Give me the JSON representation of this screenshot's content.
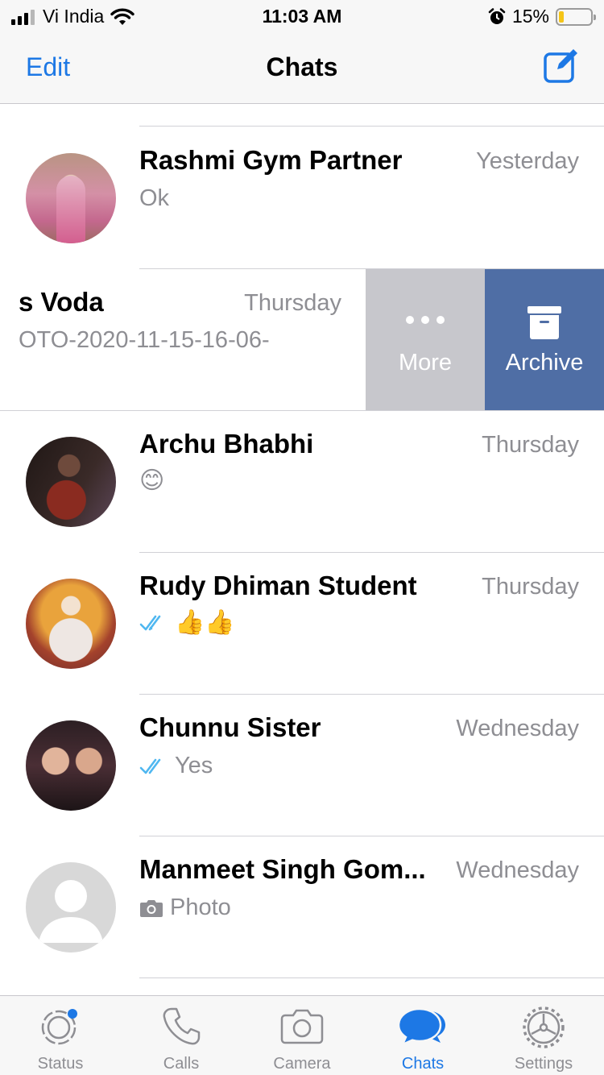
{
  "status_bar": {
    "carrier": "Vi India",
    "time": "11:03 AM",
    "battery": "15%",
    "battery_level": 0.15,
    "icons": [
      "signal-icon",
      "wifi-icon",
      "alarm-icon",
      "battery-icon"
    ]
  },
  "nav": {
    "edit": "Edit",
    "title": "Chats",
    "compose_icon": "compose-icon"
  },
  "chats": [
    {
      "name": "Rashmi Gym Partner",
      "time": "Yesterday",
      "preview": "Ok"
    },
    {
      "name": "s Voda",
      "time": "Thursday",
      "preview": "OTO-2020-11-15-16-06-"
    },
    {
      "name": "Archu Bhabhi",
      "time": "Thursday",
      "preview": "😊"
    },
    {
      "name": "Rudy Dhiman Student",
      "time": "Thursday",
      "preview": "👍👍",
      "read_ticks": true
    },
    {
      "name": "Chunnu Sister",
      "time": "Wednesday",
      "preview": "Yes",
      "read_ticks": true
    },
    {
      "name": "Manmeet Singh Gom...",
      "time": "Wednesday",
      "preview": "Photo",
      "preview_icon": "camera-icon"
    }
  ],
  "swipe_actions": {
    "more": "More",
    "archive": "Archive"
  },
  "tabs": [
    {
      "label": "Status",
      "icon": "status-icon"
    },
    {
      "label": "Calls",
      "icon": "phone-icon"
    },
    {
      "label": "Camera",
      "icon": "camera-icon"
    },
    {
      "label": "Chats",
      "icon": "chats-icon",
      "active": true
    },
    {
      "label": "Settings",
      "icon": "gear-icon"
    }
  ],
  "colors": {
    "accent": "#1d78e5",
    "archive": "#4f6ea5",
    "more": "#c7c7cc",
    "ticks": "#4fb7f0"
  }
}
